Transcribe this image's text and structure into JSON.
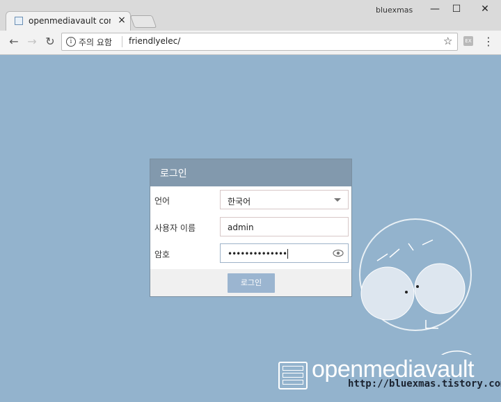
{
  "browser": {
    "tab_title": "openmediavault control",
    "tab_close": "×",
    "profile_name": "bluexmas",
    "window_minimize": "—",
    "window_maximize": "☐",
    "window_close": "✕",
    "nav_back": "←",
    "nav_forward": "→",
    "nav_reload": "↻",
    "security_label": "주의 요함",
    "url": "friendlyelec/",
    "bookmark_icon": "☆",
    "extension_label": "EX",
    "menu_icon": "⋮"
  },
  "login": {
    "title": "로그인",
    "language_label": "언어",
    "language_value": "한국어",
    "username_label": "사용자 이름",
    "username_value": "admin",
    "password_label": "암호",
    "password_value": "••••••••••••••",
    "submit_label": "로그인"
  },
  "branding": {
    "product_name": "openmediavault",
    "watermark": "http://bluexmas.tistory.com/"
  },
  "colors": {
    "background": "#93b3cd",
    "header": "#8299ad",
    "button": "#9bb5d0"
  }
}
